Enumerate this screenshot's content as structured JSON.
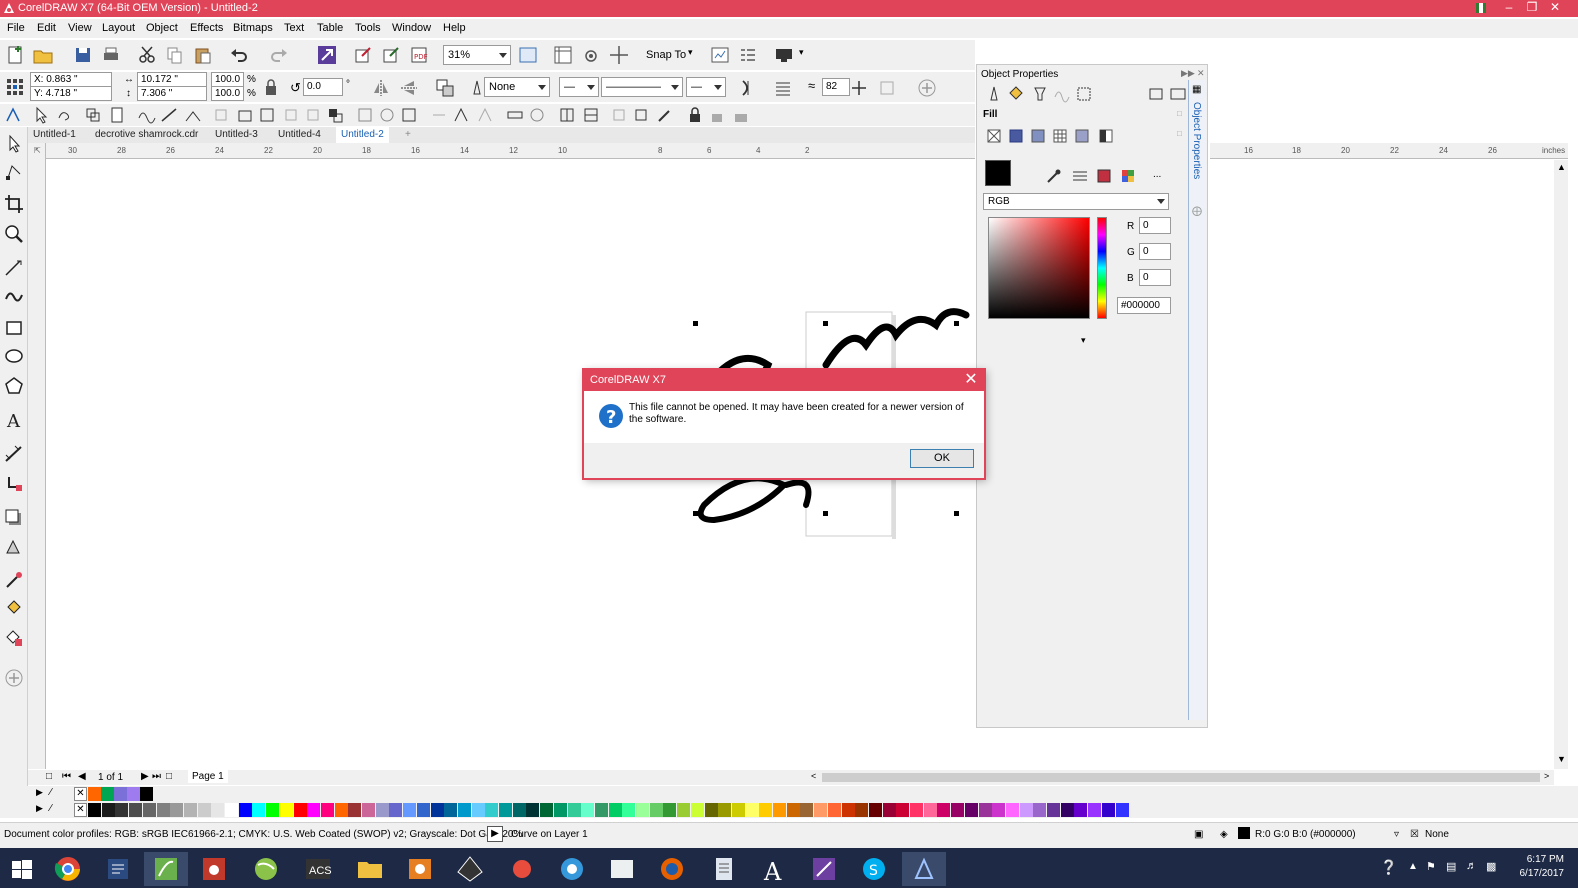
{
  "window": {
    "title": "CorelDRAW X7 (64-Bit OEM Version) - Untitled-2",
    "controls": [
      "minimize",
      "maximize",
      "close"
    ]
  },
  "menu": [
    "File",
    "Edit",
    "View",
    "Layout",
    "Object",
    "Effects",
    "Bitmaps",
    "Text",
    "Table",
    "Tools",
    "Window",
    "Help"
  ],
  "toolbar": {
    "zoom": "31%",
    "snap_to": "Snap To"
  },
  "propbar": {
    "x": "X: 0.863 \"",
    "y": "Y: 4.718 \"",
    "width": "10.172 \"",
    "height": "7.306 \"",
    "scale_w": "100.0",
    "scale_h": "100.0",
    "percent1": "%",
    "percent2": "%",
    "rotation": "0.0",
    "degree": "°",
    "outline_none": "None",
    "smooth": "82"
  },
  "doc_tabs": [
    "Untitled-1",
    "decrotive shamrock.cdr",
    "Untitled-3",
    "Untitled-4",
    "Untitled-2"
  ],
  "active_tab": "Untitled-2",
  "ruler": {
    "h_numbers": [
      "30",
      "28",
      "26",
      "24",
      "22",
      "20",
      "18",
      "16",
      "14",
      "12",
      "10",
      "8",
      "6",
      "4",
      "2"
    ],
    "h_numbers_right": [
      "16",
      "18",
      "20",
      "22",
      "24",
      "26"
    ],
    "unit": "inches"
  },
  "page_nav": {
    "position": "1 of 1",
    "page": "Page 1"
  },
  "status": {
    "profiles": "Document color profiles: RGB: sRGB IEC61966-2.1; CMYK: U.S. Web Coated (SWOP) v2; Grayscale: Dot Gain 20%",
    "selection": "Curve on Layer 1",
    "fill_info": "R:0 G:0 B:0 (#000000)",
    "outline_info": "None"
  },
  "object_properties": {
    "title": "Object Properties",
    "section": "Fill",
    "color_model": "RGB",
    "r_label": "R",
    "g_label": "G",
    "b_label": "B",
    "r": "0",
    "g": "0",
    "b": "0",
    "hex": "#000000",
    "more": "...",
    "vertical_tab": "Object Properties"
  },
  "dialog": {
    "title": "CorelDRAW X7",
    "message": "This file cannot be opened.  It may have been created for a newer version of the software.",
    "ok": "OK"
  },
  "taskbar": {
    "time": "6:17 PM",
    "date": "6/17/2017",
    "acs_label": "ACS"
  },
  "colors": {
    "title_bar": "#e04459",
    "accent_blue": "#1a5fb4",
    "taskbar": "#1e2a45",
    "fill_color": "#000000"
  },
  "palette_top": [
    "#ff6600",
    "#00a651",
    "#7b6fd8",
    "#9e7cf0",
    "#000000"
  ],
  "palette": [
    "#000000",
    "#1a1a1a",
    "#333333",
    "#4d4d4d",
    "#666666",
    "#808080",
    "#999999",
    "#b3b3b3",
    "#cccccc",
    "#e6e6e6",
    "#ffffff",
    "#0000ff",
    "#00ffff",
    "#00ff00",
    "#ffff00",
    "#ff0000",
    "#ff00ff",
    "#ff0080",
    "#ff6600",
    "#993333",
    "#cc6699",
    "#9999cc",
    "#6666cc",
    "#6699ff",
    "#3366cc",
    "#003399",
    "#006699",
    "#0099cc",
    "#66ccff",
    "#33cccc",
    "#009999",
    "#006666",
    "#003333",
    "#006633",
    "#009966",
    "#33cc99",
    "#66ffcc",
    "#339966",
    "#00cc66",
    "#33ff99",
    "#99ff99",
    "#66cc66",
    "#339933",
    "#99cc33",
    "#ccff33",
    "#666600",
    "#999900",
    "#cccc00",
    "#ffff66",
    "#ffcc00",
    "#ff9900",
    "#cc6600",
    "#996633",
    "#ff9966",
    "#ff6633",
    "#cc3300",
    "#993300",
    "#660000",
    "#990033",
    "#cc0033",
    "#ff3366",
    "#ff6699",
    "#cc0066",
    "#990066",
    "#660066",
    "#993399",
    "#cc33cc",
    "#ff66ff",
    "#cc99ff",
    "#9966cc",
    "#663399",
    "#330066",
    "#6600cc",
    "#9933ff",
    "#3300cc",
    "#3333ff"
  ]
}
